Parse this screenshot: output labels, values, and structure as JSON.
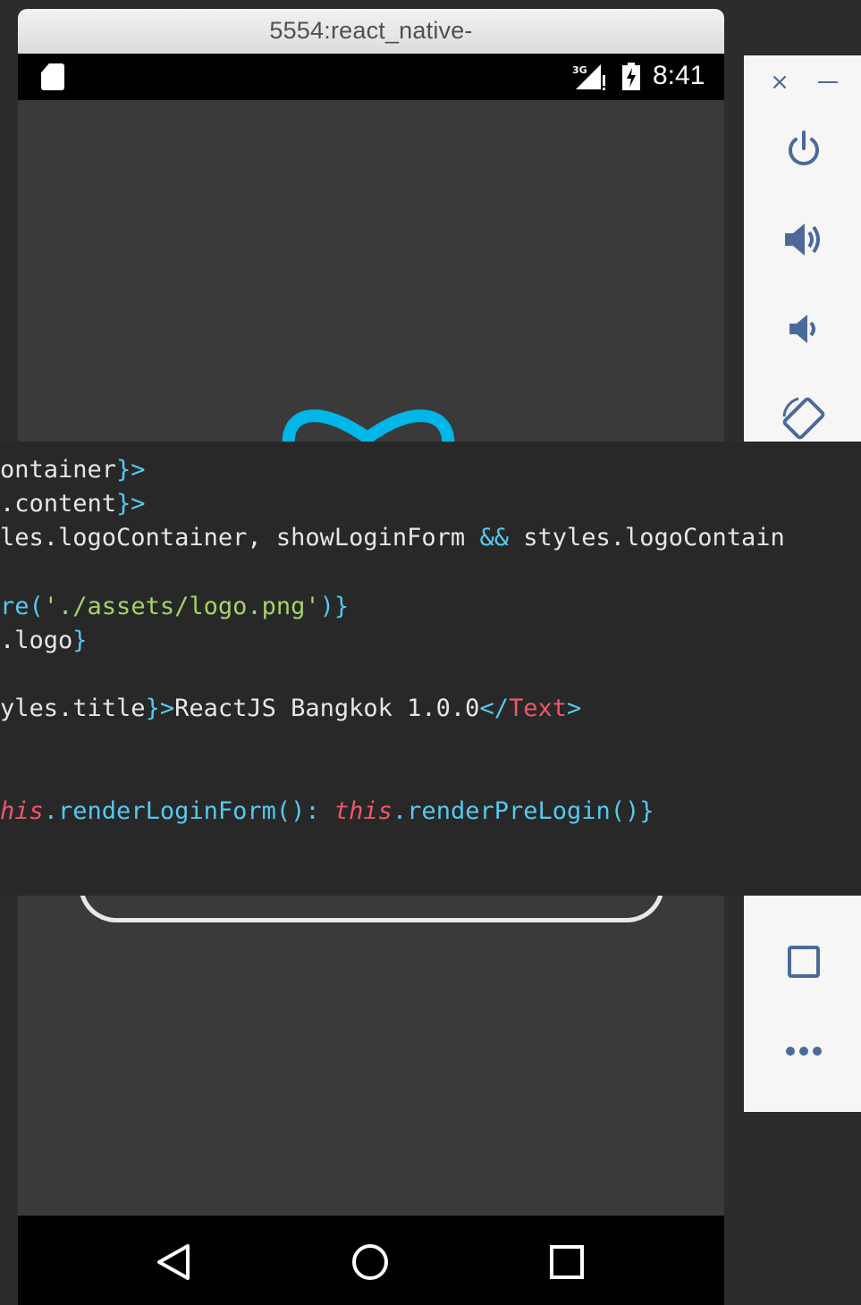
{
  "emulator": {
    "title": "5554:react_native-",
    "status_bar": {
      "time": "8:41",
      "network": "3G"
    },
    "nav": {
      "back": "back",
      "home": "home",
      "recent": "recent-apps"
    },
    "logo_color": "#00b7e8"
  },
  "toolbar": {
    "close": "×",
    "buttons": [
      "power",
      "volume-up",
      "volume-down",
      "rotate",
      "overview",
      "more"
    ]
  },
  "code": {
    "line1": {
      "t1": "ontainer",
      "t2": "}>"
    },
    "line2": {
      "t1": ".content",
      "t2": "}>"
    },
    "line3": {
      "t1": "les.logoContainer, showLoginForm ",
      "t2": "&&",
      "t3": " styles.logoContain"
    },
    "line4": {
      "t1": "re(",
      "t2": "'./assets/logo.png'",
      "t3": ")}"
    },
    "line5": {
      "t1": ".logo",
      "t2": "}"
    },
    "line6": {
      "t1": "yles.title",
      "t2": "}>",
      "t3": "ReactJS Bangkok 1.0.0",
      "t4": "</",
      "t5": "Text",
      "t6": ">"
    },
    "line7": {
      "t1": "his",
      "t2": ".renderLoginForm(): ",
      "t3": "this",
      "t4": ".renderPreLogin()}"
    }
  }
}
